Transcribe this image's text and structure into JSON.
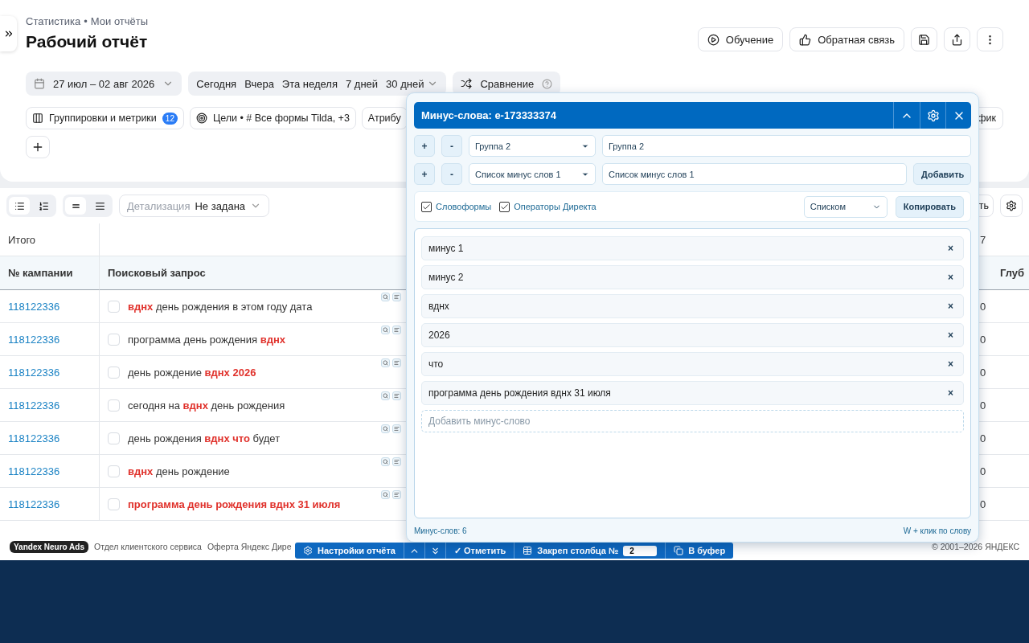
{
  "breadcrumbs": [
    "Статистика",
    "Мои отчёты"
  ],
  "breadcrumb_separator": "•",
  "title": "Рабочий отчёт",
  "header_actions": [
    {
      "kind": "text",
      "label": "Обучение"
    },
    {
      "kind": "text",
      "label": "Обратная связь"
    },
    {
      "kind": "icon"
    },
    {
      "kind": "icon"
    },
    {
      "kind": "icon"
    }
  ],
  "date_range": "27 июл – 02 авг 2026",
  "periods": [
    "Сегодня",
    "Вчера",
    "Эта неделя",
    "7 дней",
    "30 дней"
  ],
  "compare": "Сравнение",
  "chips": [
    {
      "label": "Группировки и метрики",
      "badge": "12"
    },
    {
      "label": "Цели • # Все формы Tilda, +3"
    },
    {
      "label": "Атрибу"
    }
  ],
  "chip_cut_right": "фик",
  "table_toolbar": {
    "detail_label": "Детализация",
    "detail_value": "Не задана",
    "cut_button": "ть"
  },
  "table": {
    "total_label": "Итого",
    "total_cut": "7",
    "columns": [
      "№ кампании",
      "Поисковый запрос",
      "Глуб"
    ],
    "rows": [
      {
        "campaign": "118122336",
        "checked": false,
        "query": [
          {
            "text": "вднх",
            "hl": true
          },
          {
            "text": " день рождения в этом году дата",
            "hl": false
          }
        ],
        "column_3": "0"
      },
      {
        "campaign": "118122336",
        "checked": false,
        "query": [
          {
            "text": "программа день рождения ",
            "hl": false
          },
          {
            "text": "вднх",
            "hl": true
          }
        ],
        "column_3": "0"
      },
      {
        "campaign": "118122336",
        "checked": false,
        "query": [
          {
            "text": "день рождение ",
            "hl": false
          },
          {
            "text": "вднх 2026",
            "hl": true
          }
        ],
        "column_3": "0"
      },
      {
        "campaign": "118122336",
        "checked": false,
        "query": [
          {
            "text": "сегодня на ",
            "hl": false
          },
          {
            "text": "вднх",
            "hl": true
          },
          {
            "text": " день рождения",
            "hl": false
          }
        ],
        "column_3": "0"
      },
      {
        "campaign": "118122336",
        "checked": false,
        "query": [
          {
            "text": "день рождения ",
            "hl": false
          },
          {
            "text": "вднх что",
            "hl": true
          },
          {
            "text": " будет",
            "hl": false
          }
        ],
        "column_3": "0"
      },
      {
        "campaign": "118122336",
        "checked": false,
        "query": [
          {
            "text": "вднх",
            "hl": true
          },
          {
            "text": " день рождение",
            "hl": false
          }
        ],
        "column_3": "0"
      },
      {
        "campaign": "118122336",
        "checked": false,
        "query": [
          {
            "text": "программа день рождения вднх 31 июля",
            "hl": true
          }
        ],
        "column_3": "0"
      }
    ]
  },
  "popup": {
    "title": "Минус-слова: e-173333374",
    "group_select": "Группа 2",
    "group_name": "Группа 2",
    "list_select": "Список минус слов 1",
    "list_name": "Список минус слов 1",
    "plus": "+",
    "minus": "-",
    "add_button": "Добавить",
    "options": [
      {
        "label": "Словоформы",
        "checked": true
      },
      {
        "label": "Операторы Директа",
        "checked": true
      }
    ],
    "format_select": "Списком",
    "copy_button": "Копировать",
    "words": [
      "минус 1",
      "минус 2",
      "вднх",
      "2026",
      "что",
      "программа день рождения вднх 31 июля"
    ],
    "remove": "×",
    "add_placeholder": "Добавить минус-слово",
    "count": "Минус-слов: 6",
    "hint": "W + клик по слову"
  },
  "footer": {
    "brand": "Yandex Neuro Ads",
    "links": [
      "Отдел клиентского сервиса",
      "Оферта Яндекс Дире"
    ],
    "copyright": "© 2001–2026 ЯНДЕКС"
  },
  "bottom_bar": {
    "settings": "Настройки отчёта",
    "mark": "✓ Отметить",
    "pin_label": "Закреп столбца №",
    "pin_value": "2",
    "buffer": "В буфер"
  }
}
